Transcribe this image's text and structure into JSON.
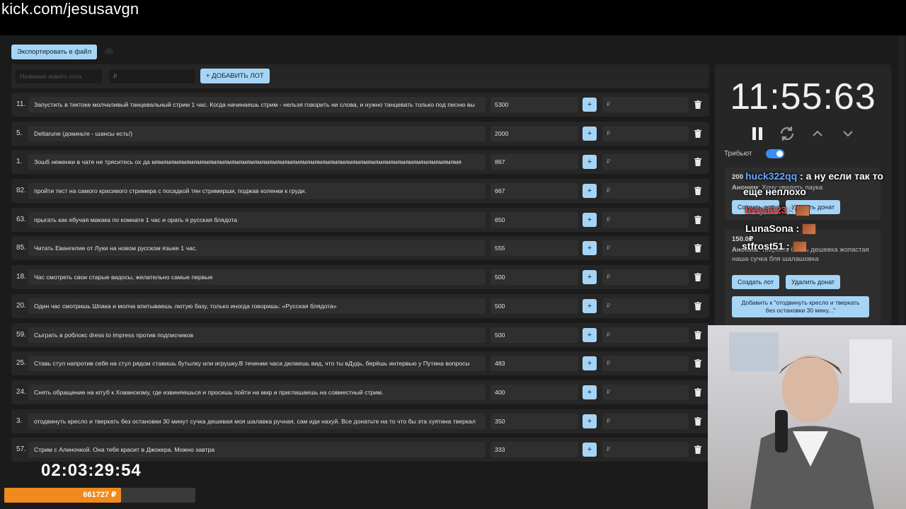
{
  "stream_url": "kick.com/jesusavgn",
  "toolbar": {
    "export_label": "Экспортировать в файл"
  },
  "add_lot": {
    "name_placeholder": "Название нового лота",
    "amount_placeholder": "₽",
    "add_label": "+ ДОБАВИТЬ ЛОТ"
  },
  "lots": [
    {
      "num": "11.",
      "name": "Запустить в тиктоке молчаливый танцевальный стрим 1 час. Когда начинаешь стрим - нельзя говорить ни слова, и нужно танцевать только под песню вы",
      "amount": "5300",
      "plus": "+",
      "currency": "₽"
    },
    {
      "num": "5.",
      "name": "Deltarune (докиньте - шансы есть!)",
      "amount": "2000",
      "plus": "+",
      "currency": "₽"
    },
    {
      "num": "1.",
      "name": "Зошб неженки в чате не тряситесь ох да мямямямямямямямямямямямямямямямямямямямямямямямямямямямямямямямямямямямямямямямямя",
      "amount": "867",
      "plus": "+",
      "currency": "₽"
    },
    {
      "num": "82.",
      "name": "пройти тест на самого красивого стримера с посадкой тян стримерши, поджав коленки к груди.",
      "amount": "667",
      "plus": "+",
      "currency": "₽"
    },
    {
      "num": "63.",
      "name": "прыгать как ебучая макака по комнате 1 час и орать я русская блядота",
      "amount": "650",
      "plus": "+",
      "currency": "₽"
    },
    {
      "num": "85.",
      "name": "Читать Евангелие от Луки на новом русском языке 1 час.",
      "amount": "555",
      "plus": "+",
      "currency": "₽"
    },
    {
      "num": "18.",
      "name": "Час смотреть свои старые видосы, желательно самые первые",
      "amount": "500",
      "plus": "+",
      "currency": "₽"
    },
    {
      "num": "20.",
      "name": "Один час смотришь Шпака и молча впитываешь лютую базу, только иногда говоришь: «Русская блядота»",
      "amount": "500",
      "plus": "+",
      "currency": "₽"
    },
    {
      "num": "59.",
      "name": "Сыграть в роблокс dress to impress против подписчиков",
      "amount": "500",
      "plus": "+",
      "currency": "₽"
    },
    {
      "num": "25.",
      "name": "Ставь стул напротив себя на стул рядом ставишь бутылку или игрушку.В течении часа делаешь вид, что ты вДудь, берёшь интервью у Путина вопросы",
      "amount": "483",
      "plus": "+",
      "currency": "₽"
    },
    {
      "num": "24.",
      "name": "Снять обращение на ютуб к Хованскому, где извиняешься и просишь пойти на мир и приглашаешь на совместный стрим.",
      "amount": "400",
      "plus": "+",
      "currency": "₽"
    },
    {
      "num": "3.",
      "name": "отодвинуть кресло и тверкать без остановки 30 минут сучка дешевая моя шалавка ручная, сам иди нахуй. Все донатьте на то что бы эта хуятина тверкал",
      "amount": "350",
      "plus": "+",
      "currency": "₽"
    },
    {
      "num": "57.",
      "name": "Стрим с Алиночкой. Она тебя красит в Джокера. Можно завтра",
      "amount": "333",
      "plus": "+",
      "currency": "₽"
    }
  ],
  "side": {
    "clock": "11:55:63",
    "tribute_label": "Трибьют",
    "tribute_on": true,
    "donation1": {
      "amount": "200",
      "author": "Аноним",
      "text": "Хочу увидеть паука",
      "create_label": "Создать лот",
      "delete_label": "Удалить донат"
    },
    "donation2": {
      "amount": "150.0₽",
      "author": "Аноним",
      "text": "тверкать блять дешевка жопастая наша сучка бля шалашовка",
      "create_label": "Создать лот",
      "delete_label": "Удалить донат",
      "add_label": "Добавить к \"отодвинуть кресло и тверкать без остановки 30 мину...\""
    }
  },
  "chat": [
    {
      "user": "huck322qq",
      "text": " : а ну если так то"
    },
    {
      "user": "",
      "text": "еще неплохо"
    },
    {
      "user": "lesya223",
      "text": " :"
    },
    {
      "user": "LunaSona",
      "text": " :"
    },
    {
      "user": "stfrost51",
      "text": " :"
    }
  ],
  "bottom": {
    "timer": "02:03:29:54",
    "progress_text": "661727 ₽",
    "progress_fraction": 0.61
  },
  "colors": {
    "accent": "#a6d4f5",
    "progress": "#f08a1c",
    "toggle": "#3d8ef0"
  }
}
